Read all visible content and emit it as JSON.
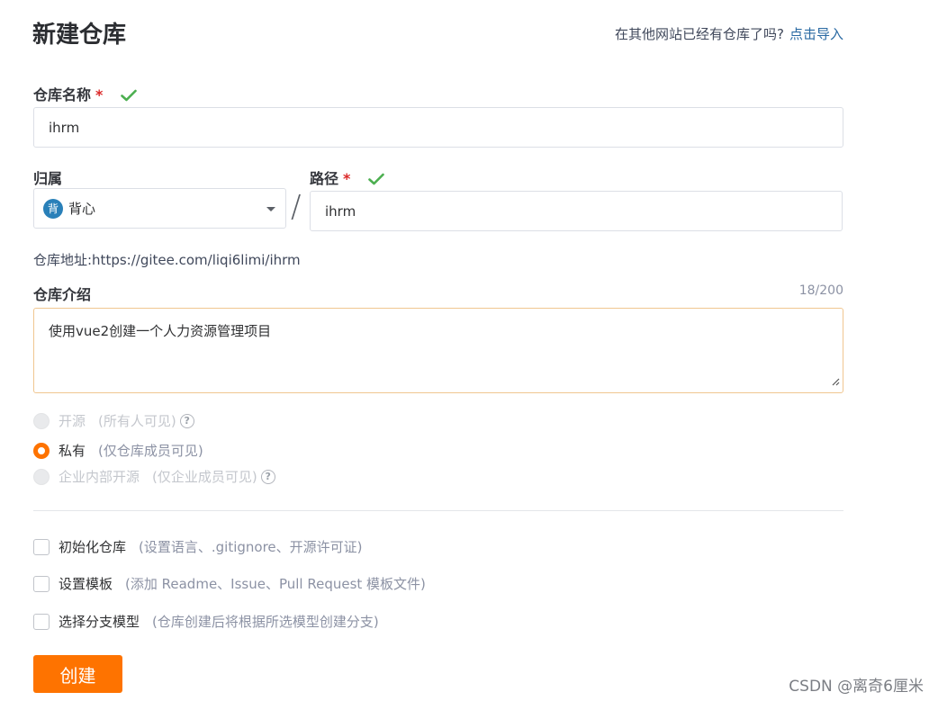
{
  "page": {
    "title": "新建仓库"
  },
  "import": {
    "prompt": "在其他网站已经有仓库了吗?",
    "link": "点击导入"
  },
  "repo_name": {
    "label": "仓库名称",
    "required_mark": "*",
    "value": "ihrm"
  },
  "owner": {
    "label": "归属",
    "avatar_char": "背",
    "value": "背心"
  },
  "separator": "/",
  "path": {
    "label": "路径",
    "required_mark": "*",
    "value": "ihrm"
  },
  "repo_address": "仓库地址:https://gitee.com/liqi6limi/ihrm",
  "description": {
    "label": "仓库介绍",
    "counter": "18/200",
    "value": "使用vue2创建一个人力资源管理项目"
  },
  "visibility": {
    "options": [
      {
        "label": "开源",
        "hint": "(所有人可见)",
        "state": "disabled",
        "help": "?"
      },
      {
        "label": "私有",
        "hint": "(仅仓库成员可见)",
        "state": "selected"
      },
      {
        "label": "企业内部开源",
        "hint": "(仅企业成员可见)",
        "state": "disabled",
        "help": "?"
      }
    ]
  },
  "options": [
    {
      "label": "初始化仓库",
      "hint": "(设置语言、.gitignore、开源许可证)",
      "checked": false
    },
    {
      "label": "设置模板",
      "hint": "(添加 Readme、Issue、Pull Request 模板文件)",
      "checked": false
    },
    {
      "label": "选择分支模型",
      "hint": "(仓库创建后将根据所选模型创建分支)",
      "checked": false
    }
  ],
  "submit": {
    "label": "创建"
  },
  "watermark": "CSDN @离奇6厘米",
  "colors": {
    "accent": "#fe7300",
    "link": "#2a6aa3",
    "valid": "#4caf50",
    "required": "#db2828"
  }
}
